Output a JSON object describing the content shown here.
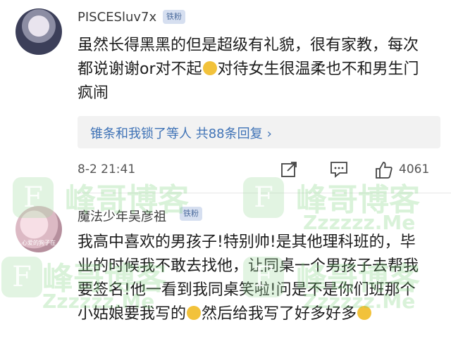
{
  "comments": [
    {
      "username": "PISCESluv7x",
      "badge": "铁粉",
      "text_lines": [
        "虽然长得黑黑的但是超级有礼貌，很有家教，每次",
        "都说谢谢or对不起",
        "对待女生很温柔也不和男生门",
        "疯闹"
      ],
      "reply_summary": "锥条和我锁了等人  共88条回复",
      "reply_chevron": "›",
      "timestamp": "8-2 21:41",
      "like_count": "4061"
    },
    {
      "username": "魔法少年吴彦祖",
      "badge": "铁粉",
      "avatar_caption": "心爱的狗子在",
      "text_lines": [
        "我高中喜欢的男孩子!特别帅!是其他理科班的，毕",
        "业的时候我不敢去找他，让同桌一个男孩子去帮我",
        "要签名!他一看到我同桌笑啦!问是不是你们班那个",
        "小姑娘要我写的",
        "然后给我写了好多好多"
      ]
    }
  ],
  "watermark": {
    "logo_letter": "F",
    "brand": "峰哥博客",
    "domain": "Zzzzzz.Me"
  },
  "colors": {
    "link_blue": "#3e72b6",
    "badge_bg": "#d6dff0",
    "badge_text": "#4c6b9c",
    "reply_bg": "#f2f2f2"
  }
}
